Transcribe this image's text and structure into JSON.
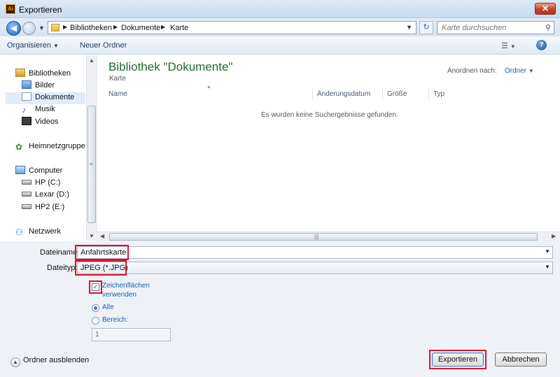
{
  "window": {
    "title": "Exportieren",
    "app_icon_label": "Ai",
    "close_label": "✕"
  },
  "address": {
    "breadcrumbs": [
      "Bibliotheken",
      "Dokumente",
      "Karte"
    ],
    "search_placeholder": "Karte durchsuchen"
  },
  "toolbar": {
    "organize": "Organisieren",
    "new_folder": "Neuer Ordner",
    "help": "?"
  },
  "sidebar": {
    "items": [
      {
        "label": "Bibliotheken",
        "icon": "libraries-icon"
      },
      {
        "label": "Bilder",
        "icon": "pictures-icon"
      },
      {
        "label": "Dokumente",
        "icon": "documents-icon",
        "selected": true
      },
      {
        "label": "Musik",
        "icon": "music-icon"
      },
      {
        "label": "Videos",
        "icon": "videos-icon"
      },
      {
        "label": "Heimnetzgruppe",
        "icon": "homegroup-icon"
      },
      {
        "label": "Computer",
        "icon": "computer-icon"
      },
      {
        "label": "HP (C:)",
        "icon": "drive-icon"
      },
      {
        "label": "Lexar (D:)",
        "icon": "drive-icon"
      },
      {
        "label": "HP2 (E:)",
        "icon": "drive-icon"
      },
      {
        "label": "Netzwerk",
        "icon": "network-icon"
      }
    ]
  },
  "content": {
    "library_title": "Bibliothek \"Dokumente\"",
    "library_subtitle": "Karte",
    "arrange_label": "Anordnen nach:",
    "arrange_value": "Ordner",
    "columns": [
      "Name",
      "Änderungsdatum",
      "Größe",
      "Typ"
    ],
    "empty_message": "Es wurden keine Suchergebnisse gefunden."
  },
  "form": {
    "filename_label": "Dateiname:",
    "filename_value": "Anfahrtskarte",
    "filetype_label": "Dateityp:",
    "filetype_value": "JPEG (*.JPG)",
    "use_artboards_line1": "Zeichenflächen",
    "use_artboards_line2": "verwenden",
    "use_artboards_checked": true,
    "all_label": "Alle",
    "range_label": "Bereich:",
    "range_value": "1",
    "hide_folders": "Ordner ausblenden",
    "export_button": "Exportieren",
    "cancel_button": "Abbrechen"
  },
  "colors": {
    "highlight_red": "#d9142b",
    "library_title_green": "#1e6a2e",
    "link_blue": "#1b5fae"
  }
}
